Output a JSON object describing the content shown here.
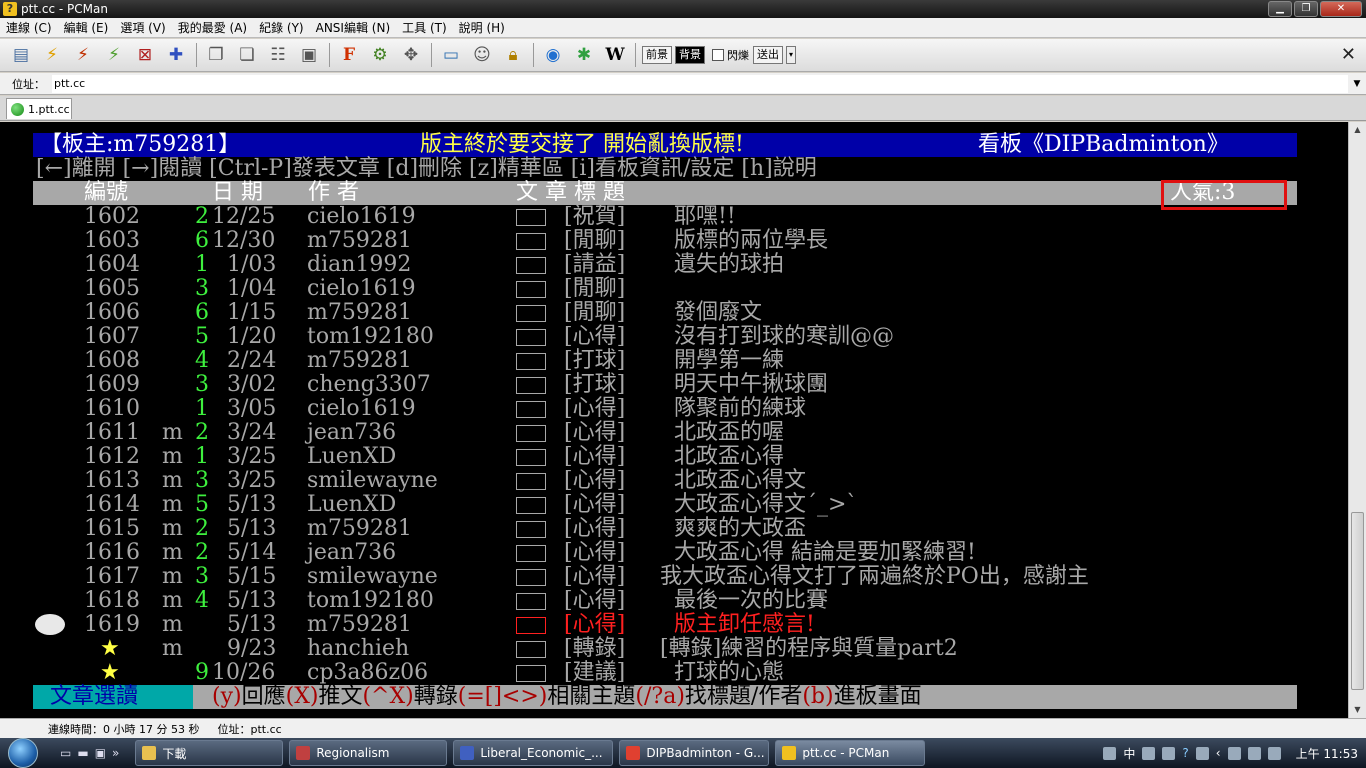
{
  "window": {
    "title": "ptt.cc - PCMan",
    "app_icon": "pcman-icon"
  },
  "menu": [
    "連線 (C)",
    "編輯 (E)",
    "選項 (V)",
    "我的最愛 (A)",
    "紀錄 (Y)",
    "ANSI編輯 (N)",
    "工具 (T)",
    "說明 (H)"
  ],
  "toolbar": {
    "icons": [
      "board-list-icon",
      "quick-connect-icon",
      "disconnect-icon",
      "reconnect-icon",
      "close-connection-icon",
      "add-favorite-icon",
      "copy-icon",
      "paste-icon",
      "copy-with-ansi-icon",
      "screenshot-icon",
      "font-icon",
      "settings-icon",
      "fullscreen-icon",
      "monitor-icon",
      "emoticon-icon",
      "lock-icon",
      "web-search-icon",
      "flower-icon",
      "wikipedia-icon"
    ],
    "fg_label": "前景",
    "bg_label": "背景",
    "blink_label": "閃爍",
    "send_label": "送出"
  },
  "address": {
    "label": "位址：",
    "value": "ptt.cc"
  },
  "tab": {
    "label": "1.ptt.cc"
  },
  "terminal": {
    "header": {
      "moderator": "【板主:m759281】",
      "notice": "版主終於要交接了 開始亂換版標!",
      "board": "看板《DIPBadminton》"
    },
    "help": "[←]離開 [→]閱讀 [Ctrl-P]發表文章 [d]刪除 [z]精華區 [i]看板資訊/設定 [h]說明",
    "columns": {
      "number": "編號",
      "date": "日 期",
      "author": "作  者",
      "title": "文  章  標  題",
      "popularity": "人氣:3"
    },
    "posts": [
      {
        "num": "1602",
        "mark": "",
        "recs": "2",
        "date": "12/25",
        "author": "cielo1619",
        "category": "[祝賀]",
        "title": "耶嘿!!",
        "current": false
      },
      {
        "num": "1603",
        "mark": "",
        "recs": "6",
        "date": "12/30",
        "author": "m759281",
        "category": "[閒聊]",
        "title": "版標的兩位學長",
        "current": false
      },
      {
        "num": "1604",
        "mark": "",
        "recs": "1",
        "date": "1/03",
        "author": "dian1992",
        "category": "[請益]",
        "title": "遺失的球拍",
        "current": false
      },
      {
        "num": "1605",
        "mark": "",
        "recs": "3",
        "date": "1/04",
        "author": "cielo1619",
        "category": "[閒聊]",
        "title": "",
        "current": false
      },
      {
        "num": "1606",
        "mark": "",
        "recs": "6",
        "date": "1/15",
        "author": "m759281",
        "category": "[閒聊]",
        "title": "發個廢文",
        "current": false
      },
      {
        "num": "1607",
        "mark": "",
        "recs": "5",
        "date": "1/20",
        "author": "tom192180",
        "category": "[心得]",
        "title": "沒有打到球的寒訓@@",
        "current": false
      },
      {
        "num": "1608",
        "mark": "",
        "recs": "4",
        "date": "2/24",
        "author": "m759281",
        "category": "[打球]",
        "title": "開學第一練",
        "current": false
      },
      {
        "num": "1609",
        "mark": "",
        "recs": "3",
        "date": "3/02",
        "author": "cheng3307",
        "category": "[打球]",
        "title": "明天中午揪球團",
        "current": false
      },
      {
        "num": "1610",
        "mark": "",
        "recs": "1",
        "date": "3/05",
        "author": "cielo1619",
        "category": "[心得]",
        "title": "隊聚前的練球",
        "current": false
      },
      {
        "num": "1611",
        "mark": "m",
        "recs": "2",
        "date": "3/24",
        "author": "jean736",
        "category": "[心得]",
        "title": "北政盃的喔",
        "current": false
      },
      {
        "num": "1612",
        "mark": "m",
        "recs": "1",
        "date": "3/25",
        "author": "LuenXD",
        "category": "[心得]",
        "title": "北政盃心得",
        "current": false
      },
      {
        "num": "1613",
        "mark": "m",
        "recs": "3",
        "date": "3/25",
        "author": "smilewayne",
        "category": "[心得]",
        "title": "北政盃心得文",
        "current": false
      },
      {
        "num": "1614",
        "mark": "m",
        "recs": "5",
        "date": "5/13",
        "author": "LuenXD",
        "category": "[心得]",
        "title": "大政盃心得文ˊ_>ˋ",
        "current": false
      },
      {
        "num": "1615",
        "mark": "m",
        "recs": "2",
        "date": "5/13",
        "author": "m759281",
        "category": "[心得]",
        "title": "爽爽的大政盃",
        "current": false
      },
      {
        "num": "1616",
        "mark": "m",
        "recs": "2",
        "date": "5/14",
        "author": "jean736",
        "category": "[心得]",
        "title": "大政盃心得 結論是要加緊練習!",
        "current": false
      },
      {
        "num": "1617",
        "mark": "m",
        "recs": "3",
        "date": "5/15",
        "author": "smilewayne",
        "category": "[心得]",
        "title": "我大政盃心得文打了兩遍終於PO出，感謝主",
        "current": false
      },
      {
        "num": "1618",
        "mark": "m",
        "recs": "4",
        "date": "5/13",
        "author": "tom192180",
        "category": "[心得]",
        "title": "最後一次的比賽",
        "current": false
      },
      {
        "num": "1619",
        "mark": "m",
        "recs": "",
        "date": "5/13",
        "author": "m759281",
        "category": "[心得]",
        "title": "版主卸任感言!",
        "current": true
      },
      {
        "num": "★",
        "mark": "m",
        "recs": "",
        "date": "9/23",
        "author": "hanchieh",
        "category": "[轉錄]",
        "title": "[轉錄]練習的程序與質量part2",
        "current": false
      },
      {
        "num": "★",
        "mark": "",
        "recs": "9",
        "date": "10/26",
        "author": "cp3a86z06",
        "category": "[建議]",
        "title": "打球的心態",
        "current": false
      }
    ],
    "footer": {
      "mode": "文章選讀",
      "keys": [
        {
          "k": "(y)",
          "t": "回應"
        },
        {
          "k": "(X)",
          "t": "推文"
        },
        {
          "k": "(^X)",
          "t": "轉錄"
        },
        {
          "k": "(=[]<>)",
          "t": "相關主題"
        },
        {
          "k": "(/?a)",
          "t": "找標題/作者"
        },
        {
          "k": "(b)",
          "t": "進板畫面"
        }
      ]
    }
  },
  "status": {
    "connection_time": "連線時間：0 小時 17 分 53 秒",
    "address": "位址：ptt.cc"
  },
  "taskbar": {
    "tasks": [
      {
        "label": "下載",
        "icon_color": "#e8c050"
      },
      {
        "label": "Regionalism",
        "icon_color": "#c04040"
      },
      {
        "label": "Liberal_Economic_...",
        "icon_color": "#4060c0"
      },
      {
        "label": "DIPBadminton - G...",
        "icon_color": "#e04030"
      },
      {
        "label": "ptt.cc - PCMan",
        "icon_color": "#f0c020"
      }
    ],
    "ime": "中",
    "clock": "上午 11:53"
  },
  "colors": {
    "terminal_bg": "#000000",
    "header_bg": "#0000a8",
    "gray": "#a8a8a8",
    "green": "#3ef03e",
    "red": "#ff2020",
    "yellow": "#ffff44",
    "cyan": "#00a8a8",
    "highlight_box": "#e01010"
  }
}
